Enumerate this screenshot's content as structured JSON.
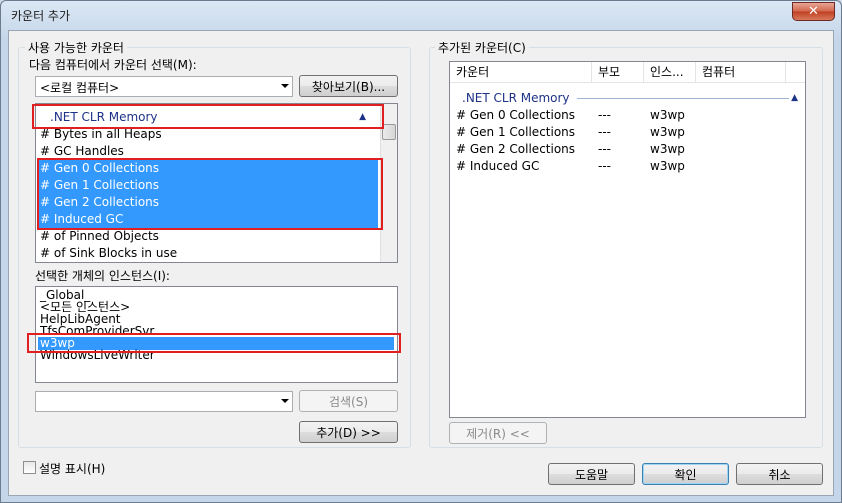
{
  "window": {
    "title": "카운터 추가",
    "close_glyph": "✕"
  },
  "available": {
    "group_label": "사용 가능한 카운터",
    "computer_label": "다음 컴퓨터에서 카운터 선택(M):",
    "computer_value": "<로컬 컴퓨터>",
    "browse_label": "찾아보기(B)...",
    "category": ".NET CLR Memory",
    "counters": [
      "# Bytes in all Heaps",
      "# GC Handles",
      "# Gen 0 Collections",
      "# Gen 1 Collections",
      "# Gen 2 Collections",
      "# Induced GC",
      "# of Pinned Objects",
      "# of Sink Blocks in use"
    ],
    "instances_label": "선택한 개체의 인스턴스(I):",
    "instances": [
      "_Global_",
      "<모든 인스턴스>",
      "HelpLibAgent",
      "TfsComProviderSvr",
      "w3wp",
      "WindowsLiveWriter"
    ],
    "search_value": "",
    "search_label": "검색(S)",
    "add_label": "추가(D) >>"
  },
  "added": {
    "group_label": "추가된 카운터(C)",
    "columns": [
      "카운터",
      "부모",
      "인스...",
      "컴퓨터"
    ],
    "category": ".NET CLR Memory",
    "rows": [
      {
        "counter": "# Gen 0 Collections",
        "parent": "---",
        "instance": "w3wp",
        "computer": ""
      },
      {
        "counter": "# Gen 1 Collections",
        "parent": "---",
        "instance": "w3wp",
        "computer": ""
      },
      {
        "counter": "# Gen 2 Collections",
        "parent": "---",
        "instance": "w3wp",
        "computer": ""
      },
      {
        "counter": "# Induced GC",
        "parent": "---",
        "instance": "w3wp",
        "computer": ""
      }
    ],
    "remove_label": "제거(R) <<"
  },
  "footer": {
    "show_desc_label": "설명 표시(H)",
    "show_desc_checked": false,
    "help_label": "도움말",
    "ok_label": "확인",
    "cancel_label": "취소"
  },
  "colors": {
    "selection": "#3399ff",
    "highlight_box": "#e02020",
    "category_text": "#1e3287"
  }
}
